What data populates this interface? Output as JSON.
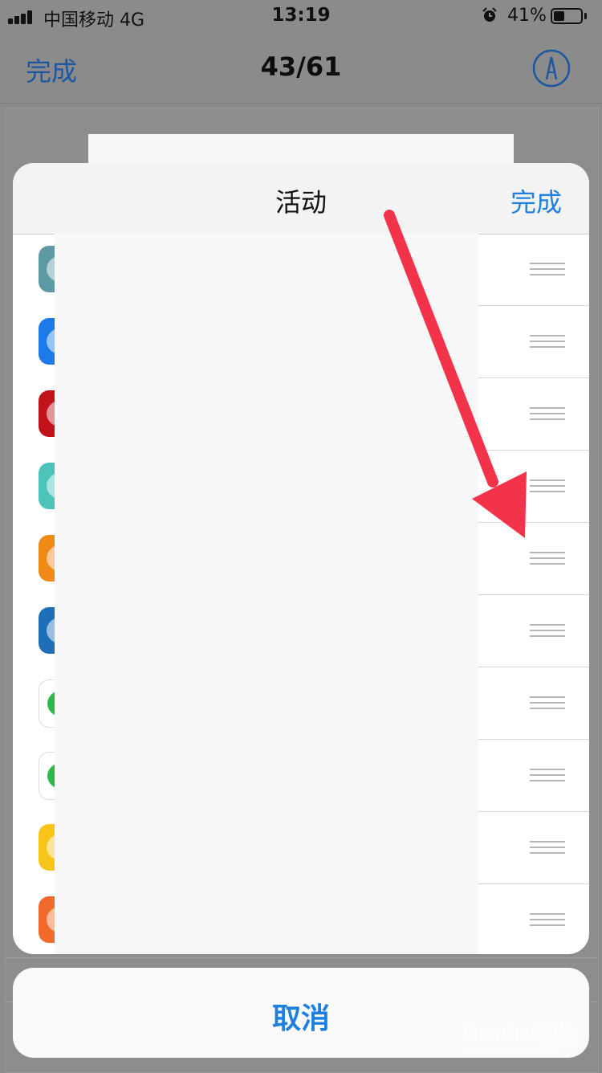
{
  "status_bar": {
    "carrier": "中国移动 4G",
    "time": "13:19",
    "battery_percent": "41%",
    "battery_level": 0.41
  },
  "nav": {
    "done_label": "完成",
    "page_counter": "43/61",
    "markup_icon": "markup-pen-icon"
  },
  "sheet": {
    "title": "活动",
    "done_label": "完成",
    "rows": [
      {
        "icon": "app-icon-teal",
        "color": "#5e9aa4"
      },
      {
        "icon": "app-icon-blue",
        "color": "#1c7be8"
      },
      {
        "icon": "app-icon-red",
        "color": "#c1131b"
      },
      {
        "icon": "app-icon-mint",
        "color": "#4cc4ba"
      },
      {
        "icon": "app-icon-orange",
        "color": "#f08a16"
      },
      {
        "icon": "app-icon-dark-blue",
        "color": "#1f6fb8"
      },
      {
        "icon": "app-icon-penguin",
        "color": "#ffffff"
      },
      {
        "icon": "app-icon-green",
        "color": "#ffffff"
      },
      {
        "icon": "app-icon-yellow",
        "color": "#f7c51a"
      },
      {
        "icon": "app-icon-orange-red",
        "color": "#f16a2c"
      }
    ]
  },
  "cancel_label": "取消",
  "annotation": {
    "color": "#f2334a"
  },
  "watermark": {
    "brand": "Baidu经验",
    "url": "jingyan.baidu.com"
  }
}
